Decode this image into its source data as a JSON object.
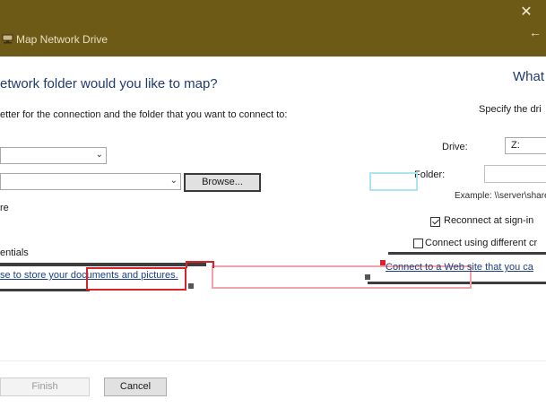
{
  "window": {
    "title": "Map Network Drive",
    "close_glyph": "✕",
    "back_glyph": "←"
  },
  "page": {
    "heading": "etwork folder would you like to map?",
    "heading_right": "What",
    "instruction": "etter for the connection and the folder that you want to connect to:",
    "instruction_right": "Specify the dri"
  },
  "form": {
    "drive_label": "Drive:",
    "drive_value": "Z:",
    "folder_label": "Folder:",
    "browse_label": "Browse...",
    "example_text": "Example: \\\\server\\share",
    "reconnect_left": "re",
    "reconnect_label": "Reconnect at sign-in",
    "reconnect_checked": true,
    "credentials_left": "entials",
    "credentials_label": "Connect using different cr",
    "credentials_checked": false
  },
  "links": {
    "left": "se to store your documents and pictures.",
    "right": "Connect to a Web site that you ca"
  },
  "footer": {
    "finish_label": "Finish",
    "cancel_label": "Cancel"
  },
  "icons": {
    "title_icon": "network-drive-icon",
    "combo_arrow": "chevron-down-icon"
  },
  "colors": {
    "titlebar": "#6e5a17",
    "link": "#1c3f84",
    "highlight_red": "#d8232a"
  }
}
